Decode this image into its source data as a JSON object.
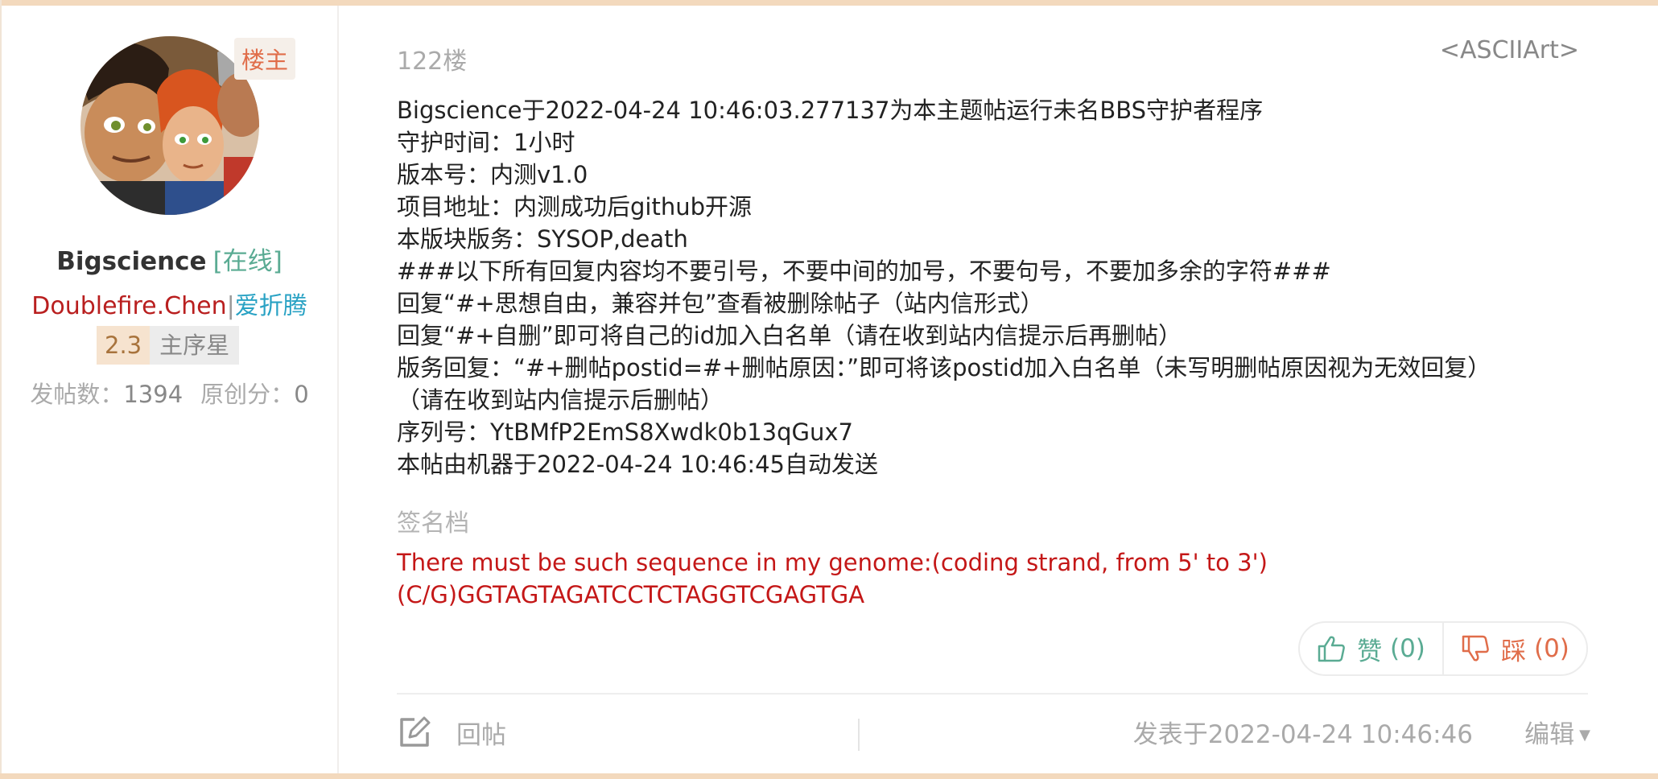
{
  "author": {
    "owner_badge": "楼主",
    "username": "Bigscience",
    "online_status": "[在线]",
    "signature_name": "Doublefire.Chen",
    "separator": "|",
    "hobby": "爱折腾",
    "level_number": "2.3",
    "level_title": "主序星",
    "posts_label": "发帖数：",
    "posts_count": "1394",
    "original_label": "原创分：",
    "original_score": "0"
  },
  "post": {
    "floor": "122楼",
    "ascii_link": "<ASCIIArt>",
    "lines": [
      "Bigscience于2022-04-24 10:46:03.277137为本主题帖运行未名BBS守护者程序",
      "守护时间：1小时",
      "版本号：内测v1.0",
      "项目地址：内测成功后github开源",
      "本版块版务：SYSOP,death",
      "###以下所有回复内容均不要引号，不要中间的加号，不要句号，不要加多余的字符###",
      "回复“#+思想自由，兼容并包”查看被删除帖子（站内信形式）",
      "回复“#+自删”即可将自己的id加入白名单（请在收到站内信提示后再删帖）",
      "版务回复：“#+删帖postid=#+删帖原因：”即可将该postid加入白名单（未写明删帖原因视为无效回复）",
      "（请在收到站内信提示后删帖）",
      "序列号：YtBMfP2EmS8Xwdk0b13qGux7",
      "本帖由机器于2022-04-24 10:46:45自动发送"
    ],
    "signature_label": "签名档",
    "signature_lines": [
      "There must be such sequence in my genome:(coding strand, from 5' to 3')",
      "(C/G)GGTAGTAGATCCTCTAGGTCGAGTGA"
    ]
  },
  "actions": {
    "like_label": "赞",
    "like_count": "(0)",
    "dislike_label": "踩",
    "dislike_count": "(0)",
    "reply_label": "回帖",
    "post_time": "发表于2022-04-24 10:46:46",
    "edit_label": "编辑"
  },
  "colors": {
    "accent_border": "#f3d9bd",
    "online_green": "#5aab93",
    "signature_red": "#c41717",
    "owner_orange": "#e06d4a",
    "hobby_blue": "#29a2c4"
  }
}
